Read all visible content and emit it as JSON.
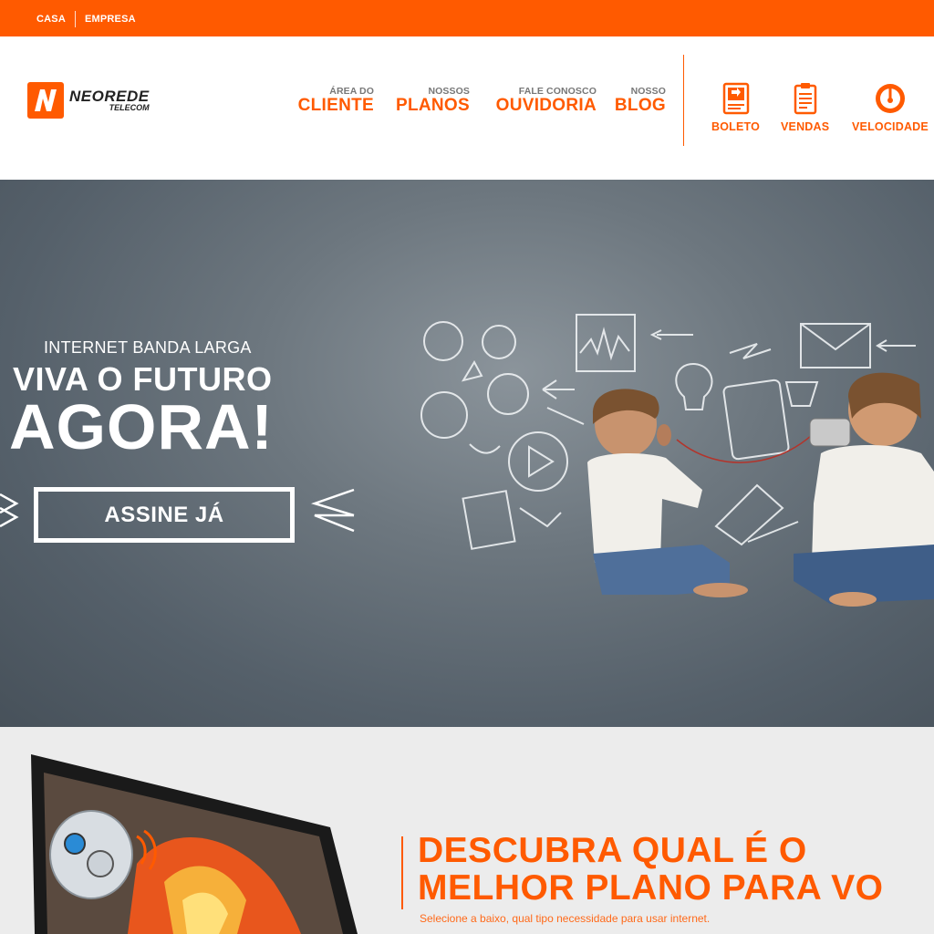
{
  "topbar": {
    "links": [
      "CASA",
      "EMPRESA"
    ]
  },
  "brand": {
    "name": "NEOREDE",
    "sub": "TELECOM",
    "mark": "N"
  },
  "nav": [
    {
      "small": "ÁREA DO",
      "big": "CLIENTE"
    },
    {
      "small": "NOSSOS",
      "big": "PLANOS"
    },
    {
      "small": "FALE CONOSCO",
      "big": "OUVIDORIA"
    },
    {
      "small": "NOSSO",
      "big": "BLOG"
    }
  ],
  "tools": [
    {
      "label": "BOLETO",
      "icon": "invoice-icon"
    },
    {
      "label": "VENDAS",
      "icon": "clipboard-icon"
    },
    {
      "label": "VELOCIDADE",
      "icon": "speedometer-icon"
    }
  ],
  "hero": {
    "subtitle": "INTERNET BANDA LARGA",
    "headline1": "VIVA O FUTURO",
    "headline2": "AGORA!",
    "cta": "ASSINE JÁ"
  },
  "plans": {
    "title_line1": "DESCUBRA QUAL É O",
    "title_line2": "MELHOR PLANO PARA VO",
    "description": "Selecione a baixo, qual tipo necessidade para usar internet."
  },
  "colors": {
    "accent": "#ff5a00",
    "hero_bg": "#6d777f",
    "section_bg": "#ececec"
  }
}
